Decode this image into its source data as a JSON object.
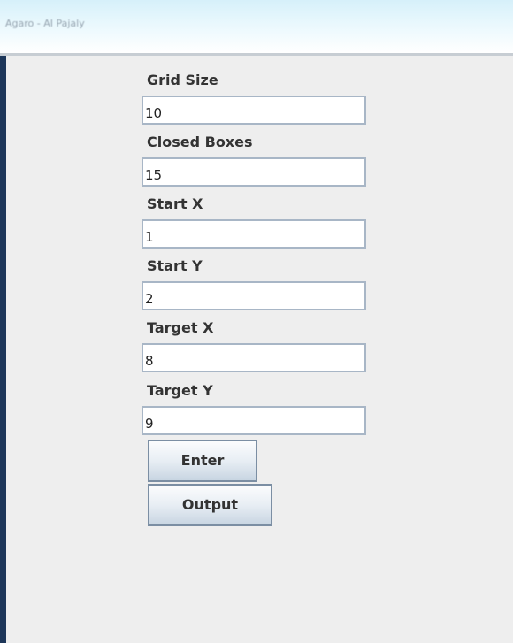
{
  "window": {
    "title": "Agaro - AI Pajaly"
  },
  "form": {
    "fields": [
      {
        "label": "Grid Size",
        "value": "10"
      },
      {
        "label": "Closed Boxes",
        "value": "15"
      },
      {
        "label": "Start X",
        "value": "1"
      },
      {
        "label": "Start Y",
        "value": "2"
      },
      {
        "label": "Target X",
        "value": "8"
      },
      {
        "label": "Target Y",
        "value": "9"
      }
    ],
    "buttons": {
      "enter_label": "Enter",
      "output_label": "Output"
    }
  },
  "colors": {
    "window_frame": "#1d3659",
    "panel_background": "#eeeeee",
    "input_border": "#a8b6c6",
    "button_border": "#7b8ea3"
  }
}
